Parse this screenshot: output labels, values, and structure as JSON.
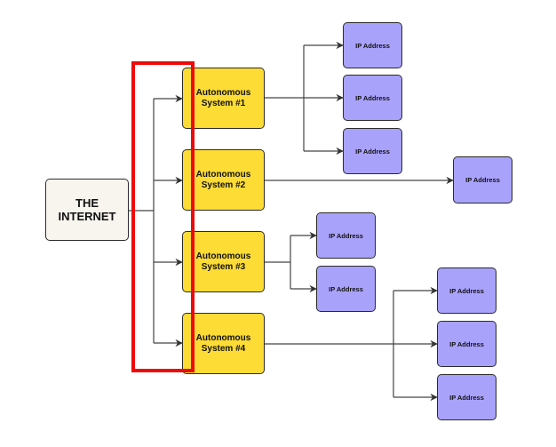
{
  "diagram": {
    "root": {
      "label": "THE\nINTERNET"
    },
    "autonomous_systems": [
      {
        "label": "Autonomous\nSystem #1"
      },
      {
        "label": "Autonomous\nSystem #2"
      },
      {
        "label": "Autonomous\nSystem #3"
      },
      {
        "label": "Autonomous\nSystem #4"
      }
    ],
    "ip_addresses": [
      {
        "label": "IP Address",
        "parent": "Autonomous System #1"
      },
      {
        "label": "IP Address",
        "parent": "Autonomous System #1"
      },
      {
        "label": "IP Address",
        "parent": "Autonomous System #1"
      },
      {
        "label": "IP Address",
        "parent": "Autonomous System #2"
      },
      {
        "label": "IP Address",
        "parent": "Autonomous System #3"
      },
      {
        "label": "IP Address",
        "parent": "Autonomous System #3"
      },
      {
        "label": "IP Address",
        "parent": "Autonomous System #4"
      },
      {
        "label": "IP Address",
        "parent": "Autonomous System #4"
      },
      {
        "label": "IP Address",
        "parent": "Autonomous System #4"
      }
    ],
    "highlight": {
      "description": "red box highlighting connections from The Internet to autonomous systems",
      "color": "#ee0a0a"
    },
    "colors": {
      "internet": "#f8f5ee",
      "autonomous_system": "#fcdc35",
      "ip_address": "#a9a2fb",
      "connector": "#333333"
    }
  }
}
